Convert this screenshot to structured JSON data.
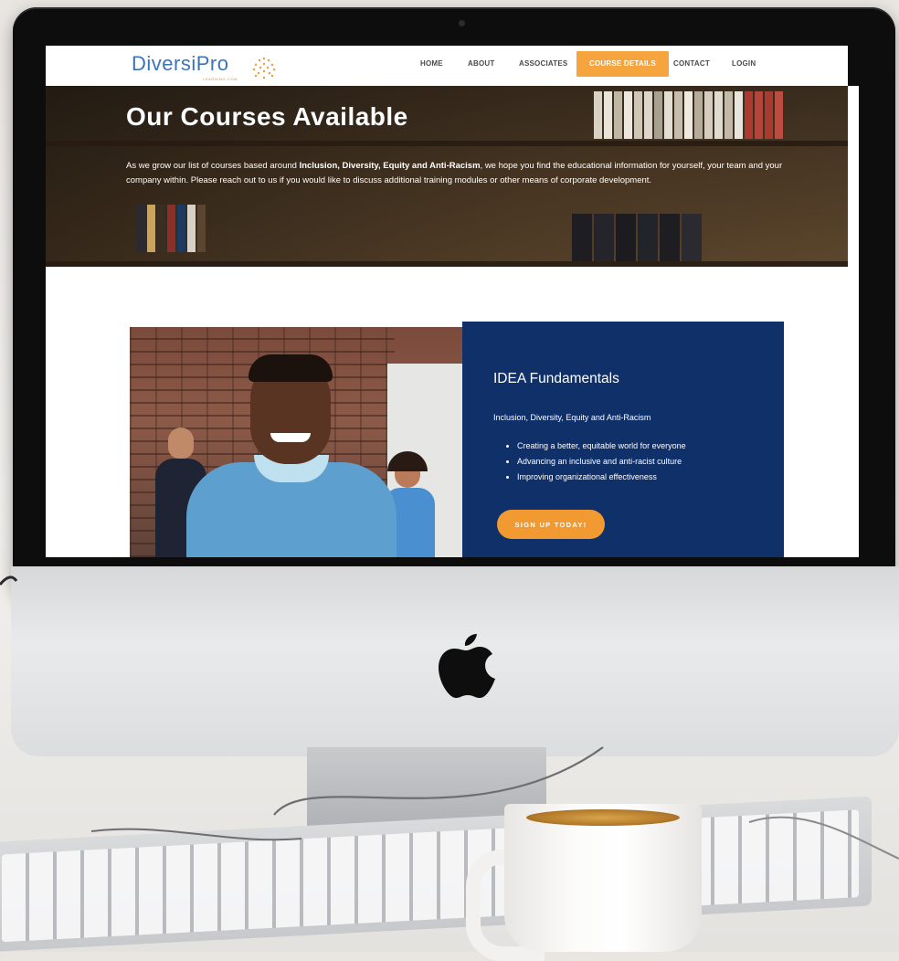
{
  "brand": {
    "name": "DiversiPro",
    "tagline": "LEARNING.COM",
    "primary_color": "#3c74b8",
    "accent_color": "#f6a43d",
    "panel_color": "#10306a"
  },
  "nav": {
    "items": [
      {
        "label": "HOME"
      },
      {
        "label": "ABOUT"
      },
      {
        "label": "ASSOCIATES"
      },
      {
        "label": "COURSE DETAILS",
        "active": true
      },
      {
        "label": "CONTACT"
      },
      {
        "label": "LOGIN"
      }
    ]
  },
  "hero": {
    "title": "Our Courses Available",
    "intro_start": "As we grow our list of courses based around ",
    "intro_bold": "Inclusion, Diversity, Equity and Anti-Racism",
    "intro_end": ", we hope you find the educational information for yourself, your team and your company within. Please reach out to us if you would like to discuss additional training modules or other means of corporate development."
  },
  "course": {
    "title": "IDEA Fundamentals",
    "subtitle": "Inclusion, Diversity, Equity and Anti-Racism",
    "bullets": [
      "Creating a better, equitable world for everyone",
      "Advancing an inclusive and anti-racist culture",
      "Improving organizational effectiveness"
    ],
    "cta_label": "SIGN UP TODAY!"
  },
  "icons": {
    "logo_mark": "dots-cluster-icon",
    "hardware_logo": "apple-icon"
  }
}
